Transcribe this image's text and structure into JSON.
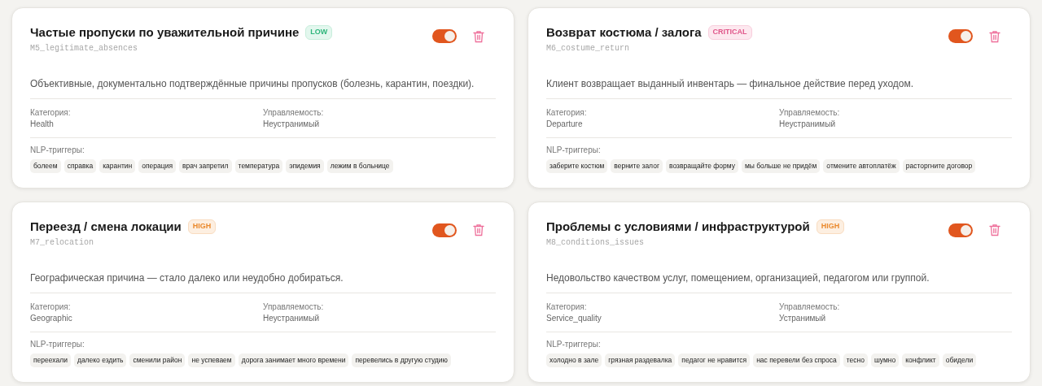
{
  "cards": [
    {
      "title": "Частые пропуски по уважительной причине",
      "severity": {
        "kind": "low",
        "label": "LOW"
      },
      "code": "M5_legitimate_absences",
      "enabled": true,
      "description": "Объективные, документально подтверждённые причины пропусков (болезнь, карантин, поездки).",
      "category_label": "Категория:",
      "category": "Health",
      "control_label": "Управляемость:",
      "control": "Неустранимый",
      "triggers_label": "NLP-триггеры:",
      "triggers": [
        "болеем",
        "справка",
        "карантин",
        "операция",
        "врач запретил",
        "температура",
        "эпидемия",
        "лежим в больнице"
      ]
    },
    {
      "title": "Возврат костюма / залога",
      "severity": {
        "kind": "critical",
        "label": "CRITICAL"
      },
      "code": "M6_costume_return",
      "enabled": true,
      "description": "Клиент возвращает выданный инвентарь — финальное действие перед уходом.",
      "category_label": "Категория:",
      "category": "Departure",
      "control_label": "Управляемость:",
      "control": "Неустранимый",
      "triggers_label": "NLP-триггеры:",
      "triggers": [
        "заберите костюм",
        "верните залог",
        "возвращайте форму",
        "мы больше не придём",
        "отмените автоплатёж",
        "расторгните договор"
      ]
    },
    {
      "title": "Переезд / смена локации",
      "severity": {
        "kind": "high",
        "label": "HIGH"
      },
      "code": "M7_relocation",
      "enabled": true,
      "description": "Географическая причина — стало далеко или неудобно добираться.",
      "category_label": "Категория:",
      "category": "Geographic",
      "control_label": "Управляемость:",
      "control": "Неустранимый",
      "triggers_label": "NLP-триггеры:",
      "triggers": [
        "переехали",
        "далеко ездить",
        "сменили район",
        "не успеваем",
        "дорога занимает много времени",
        "перевелись в другую студию"
      ]
    },
    {
      "title": "Проблемы с условиями / инфраструктурой",
      "severity": {
        "kind": "high",
        "label": "HIGH"
      },
      "code": "M8_conditions_issues",
      "enabled": true,
      "description": "Недовольство качеством услуг, помещением, организацией, педагогом или группой.",
      "category_label": "Категория:",
      "category": "Service_quality",
      "control_label": "Управляемость:",
      "control": "Устранимый",
      "triggers_label": "NLP-триггеры:",
      "triggers": [
        "холодно в зале",
        "грязная раздевалка",
        "педагог не нравится",
        "нас перевели без спроса",
        "тесно",
        "шумно",
        "конфликт",
        "обидели"
      ]
    }
  ]
}
